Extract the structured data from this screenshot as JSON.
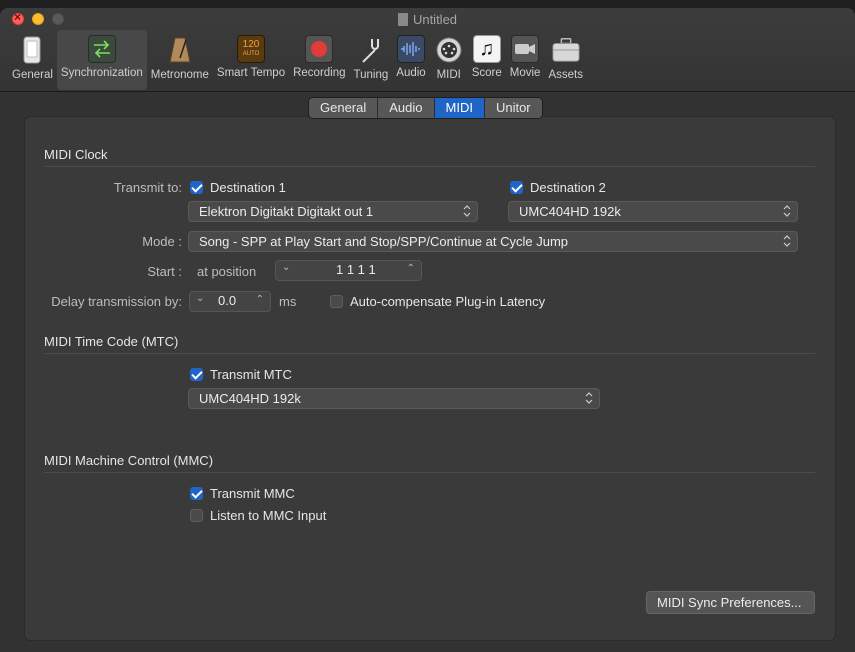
{
  "window": {
    "title": "Untitled"
  },
  "toolbar": [
    {
      "label": "General",
      "icon": "phone-icon"
    },
    {
      "label": "Synchronization",
      "icon": "sync-arrows-icon"
    },
    {
      "label": "Metronome",
      "icon": "metronome-icon"
    },
    {
      "label": "Smart Tempo",
      "icon": "smart-tempo-icon",
      "badge_top": "120",
      "badge_bottom": "AUTO"
    },
    {
      "label": "Recording",
      "icon": "record-icon"
    },
    {
      "label": "Tuning",
      "icon": "tuning-fork-icon"
    },
    {
      "label": "Audio",
      "icon": "waveform-icon"
    },
    {
      "label": "MIDI",
      "icon": "midi-port-icon"
    },
    {
      "label": "Score",
      "icon": "music-note-icon"
    },
    {
      "label": "Movie",
      "icon": "camera-icon"
    },
    {
      "label": "Assets",
      "icon": "briefcase-icon"
    }
  ],
  "tabs": [
    "General",
    "Audio",
    "MIDI",
    "Unitor"
  ],
  "active_tab": "MIDI",
  "midi_clock": {
    "title": "MIDI Clock",
    "transmit_label": "Transmit to:",
    "dest1_label": "Destination 1",
    "dest1_checked": true,
    "dest1_device": "Elektron Digitakt Digitakt out 1",
    "dest2_label": "Destination 2",
    "dest2_checked": true,
    "dest2_device": "UMC404HD 192k",
    "mode_label": "Mode :",
    "mode_value": "Song - SPP at Play Start and Stop/SPP/Continue at Cycle Jump",
    "start_label": "Start :",
    "start_prefix": "at position",
    "start_value": "1  1  1      1",
    "delay_label": "Delay transmission by:",
    "delay_value": "0.0",
    "delay_unit": "ms",
    "autocomp_label": "Auto-compensate Plug-in Latency",
    "autocomp_checked": false
  },
  "mtc": {
    "title": "MIDI Time Code (MTC)",
    "transmit_label": "Transmit MTC",
    "transmit_checked": true,
    "device": "UMC404HD 192k"
  },
  "mmc": {
    "title": "MIDI Machine Control (MMC)",
    "transmit_label": "Transmit MMC",
    "transmit_checked": true,
    "listen_label": "Listen to MMC Input",
    "listen_checked": false
  },
  "prefs_button": "MIDI Sync Preferences...",
  "colors": {
    "accent": "#1f64c7",
    "record": "#e23b3b",
    "tempo_badge": "#8a5200"
  }
}
